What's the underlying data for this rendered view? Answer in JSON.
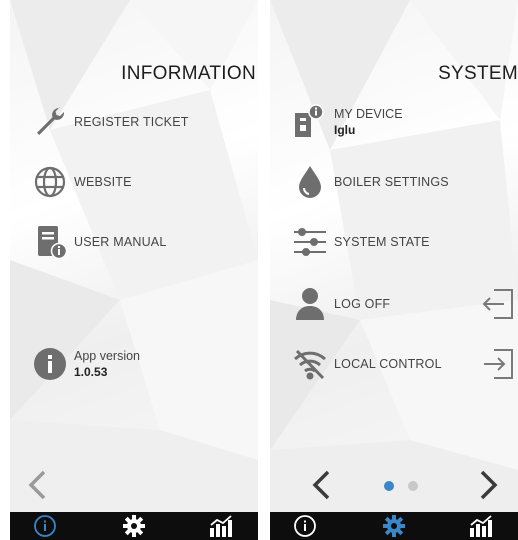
{
  "colors": {
    "accent": "#3a86c8",
    "icon": "#6e6e6e",
    "tabbar": "#0d0d0d",
    "dot_inactive": "#c8c8c8"
  },
  "information": {
    "title": "INFORMATION",
    "items": [
      {
        "icon": "wrench-icon",
        "label": "REGISTER TICKET"
      },
      {
        "icon": "globe-icon",
        "label": "WEBSITE"
      },
      {
        "icon": "manual-book-icon",
        "label": "USER MANUAL"
      }
    ],
    "app_version": {
      "icon": "info-icon",
      "label": "App version",
      "value": "1.0.53"
    }
  },
  "system": {
    "title": "SYSTEM",
    "items": [
      {
        "icon": "device-info-icon",
        "label": "MY DEVICE",
        "value": "Iglu"
      },
      {
        "icon": "water-drop-icon",
        "label": "BOILER SETTINGS"
      },
      {
        "icon": "sliders-icon",
        "label": "SYSTEM STATE"
      },
      {
        "icon": "user-icon",
        "label": "LOG OFF"
      },
      {
        "icon": "wifi-off-icon",
        "label": "LOCAL CONTROL"
      }
    ],
    "pager": {
      "active": 0,
      "count": 2
    }
  },
  "tabbar": {
    "tabs": [
      "info-tab-icon",
      "settings-tab-icon",
      "statistics-tab-icon"
    ]
  }
}
